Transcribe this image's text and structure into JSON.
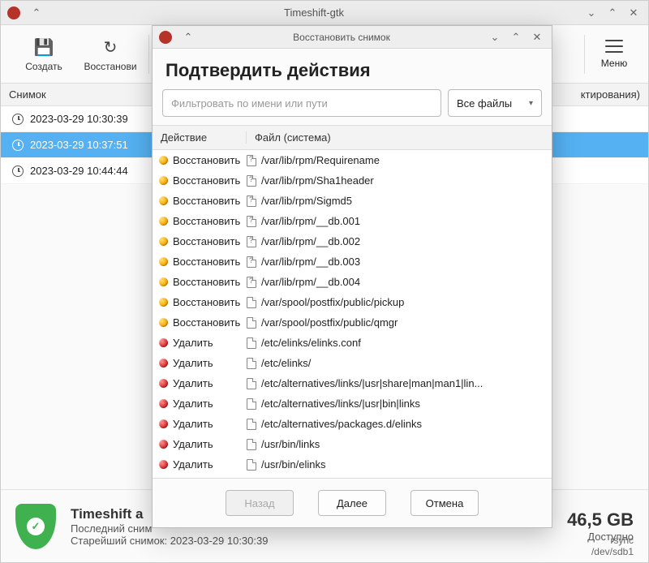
{
  "main_window": {
    "title": "Timeshift-gtk"
  },
  "toolbar": {
    "create": "Создать",
    "restore": "Восстанови",
    "menu": "Меню"
  },
  "snap_header": {
    "col_snapshot": "Снимок",
    "col_tags": "ктирования)"
  },
  "snapshots": [
    {
      "time": "2023-03-29 10:30:39",
      "selected": false
    },
    {
      "time": "2023-03-29 10:37:51",
      "selected": true
    },
    {
      "time": "2023-03-29 10:44:44",
      "selected": false
    }
  ],
  "footer": {
    "title": "Timeshift a",
    "last_label": "Последний сним",
    "oldest_label": "Старейший снимок:",
    "oldest_value": "2023-03-29 10:30:39",
    "size": "46,5 GB",
    "available": "Доступно",
    "mode": "rsync",
    "device": "/dev/sdb1"
  },
  "dialog": {
    "title": "Восстановить снимок",
    "heading": "Подтвердить действия",
    "filter_placeholder": "Фильтровать по имени или пути",
    "file_select": "Все файлы",
    "col_action": "Действие",
    "col_file": "Файл (система)",
    "rows": [
      {
        "kind": "restore",
        "action": "Восстановить",
        "file": "/var/lib/rpm/Requirename",
        "q": true
      },
      {
        "kind": "restore",
        "action": "Восстановить",
        "file": "/var/lib/rpm/Sha1header",
        "q": true
      },
      {
        "kind": "restore",
        "action": "Восстановить",
        "file": "/var/lib/rpm/Sigmd5",
        "q": true
      },
      {
        "kind": "restore",
        "action": "Восстановить",
        "file": "/var/lib/rpm/__db.001",
        "q": true
      },
      {
        "kind": "restore",
        "action": "Восстановить",
        "file": "/var/lib/rpm/__db.002",
        "q": true
      },
      {
        "kind": "restore",
        "action": "Восстановить",
        "file": "/var/lib/rpm/__db.003",
        "q": true
      },
      {
        "kind": "restore",
        "action": "Восстановить",
        "file": "/var/lib/rpm/__db.004",
        "q": true
      },
      {
        "kind": "restore",
        "action": "Восстановить",
        "file": "/var/spool/postfix/public/pickup",
        "q": false
      },
      {
        "kind": "restore",
        "action": "Восстановить",
        "file": "/var/spool/postfix/public/qmgr",
        "q": false
      },
      {
        "kind": "delete",
        "action": "Удалить",
        "file": "/etc/elinks/elinks.conf",
        "q": false
      },
      {
        "kind": "delete",
        "action": "Удалить",
        "file": "/etc/elinks/",
        "q": false
      },
      {
        "kind": "delete",
        "action": "Удалить",
        "file": "/etc/alternatives/links/|usr|share|man|man1|lin...",
        "q": false
      },
      {
        "kind": "delete",
        "action": "Удалить",
        "file": "/etc/alternatives/links/|usr|bin|links",
        "q": false
      },
      {
        "kind": "delete",
        "action": "Удалить",
        "file": "/etc/alternatives/packages.d/elinks",
        "q": false
      },
      {
        "kind": "delete",
        "action": "Удалить",
        "file": "/usr/bin/links",
        "q": false
      },
      {
        "kind": "delete",
        "action": "Удалить",
        "file": "/usr/bin/elinks",
        "q": false
      }
    ],
    "btn_back": "Назад",
    "btn_next": "Далее",
    "btn_cancel": "Отмена"
  }
}
